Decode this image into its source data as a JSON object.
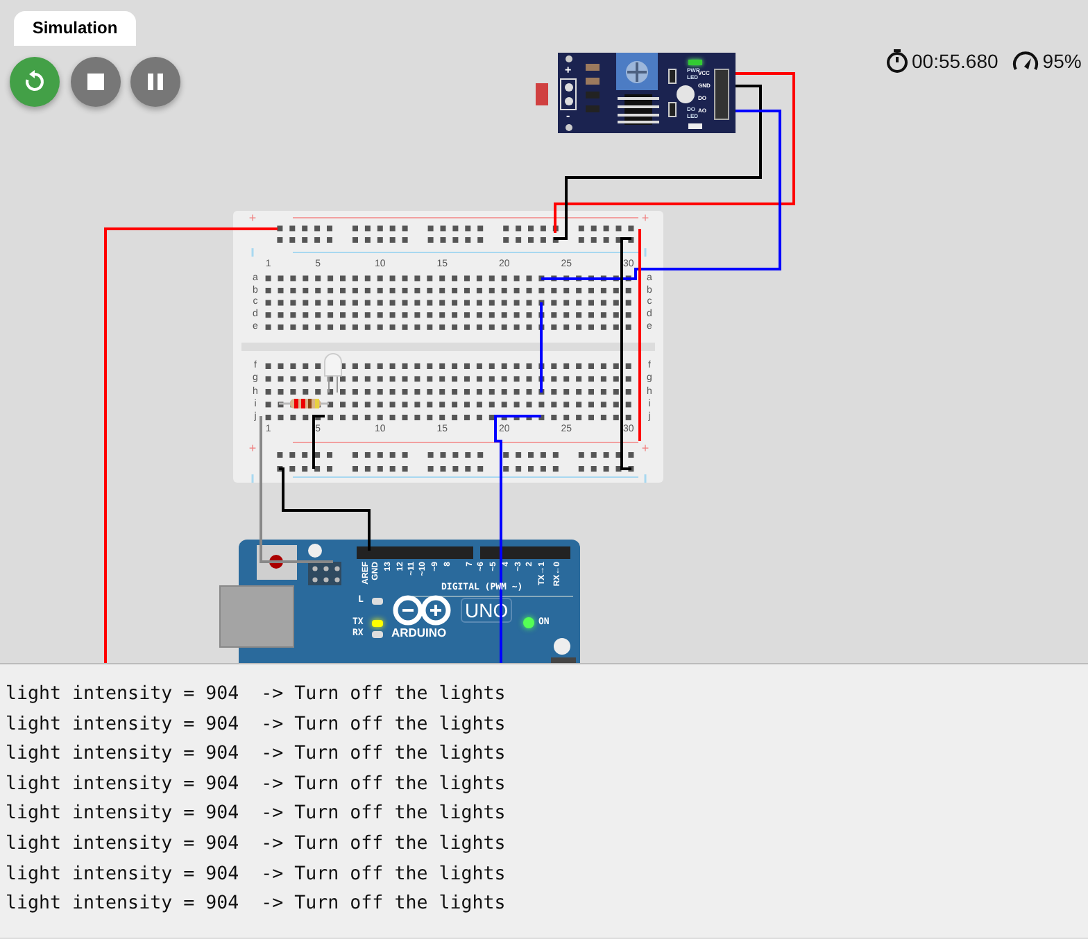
{
  "tab": {
    "label": "Simulation",
    "selected": true
  },
  "controls": [
    {
      "kind": "restart"
    },
    {
      "kind": "stop"
    },
    {
      "kind": "pause"
    }
  ],
  "timer": "00:55.680",
  "speed": "95%",
  "sensor_module": {
    "plus": "+",
    "minus": "-",
    "pin_labels": [
      "VCC",
      "GND",
      "DO",
      "AO"
    ],
    "power_led_label": [
      "PWR",
      "LED"
    ],
    "power_led_on": true,
    "do_led_label": [
      "DO",
      "LED"
    ],
    "do_led_on": false
  },
  "breadboard": {
    "rail_marks": [
      "+",
      "+",
      "+",
      "+"
    ],
    "top_numbers": [
      "1",
      "5",
      "10",
      "15",
      "20",
      "25",
      "30"
    ],
    "bottom_numbers": [
      "1",
      "5",
      "10",
      "15",
      "20",
      "25",
      "30"
    ],
    "upper_rows_left": [
      "a",
      "b",
      "c",
      "d",
      "e"
    ],
    "upper_rows_right": [
      "a",
      "b",
      "c",
      "d",
      "e"
    ],
    "lower_rows_left": [
      "f",
      "g",
      "h",
      "i",
      "j"
    ],
    "lower_rows_right": [
      "f",
      "g",
      "h",
      "i",
      "j"
    ]
  },
  "arduino": {
    "pin_labels": [
      "AREF",
      "GND",
      "13",
      "12",
      "~11",
      "~10",
      "~9",
      "8",
      "7",
      "~6",
      "~5",
      "4",
      "~3",
      "2",
      "TX→1",
      "RX←0"
    ],
    "header_label": "DIGITAL (PWM ~)",
    "l_label": "L",
    "l_led_on": false,
    "tx_label": "TX",
    "tx_led_on": true,
    "rx_label": "RX",
    "rx_led_on": false,
    "brand": "ARDUINO",
    "model": "UNO",
    "on_label": "ON",
    "on_led_on": true
  },
  "serial_monitor": {
    "lines": [
      "light intensity = 904  -> Turn off the lights",
      "light intensity = 904  -> Turn off the lights",
      "light intensity = 904  -> Turn off the lights",
      "light intensity = 904  -> Turn off the lights",
      "light intensity = 904  -> Turn off the lights",
      "light intensity = 904  -> Turn off the lights",
      "light intensity = 904  -> Turn off the lights",
      "light intensity = 904  -> Turn off the lights"
    ]
  }
}
